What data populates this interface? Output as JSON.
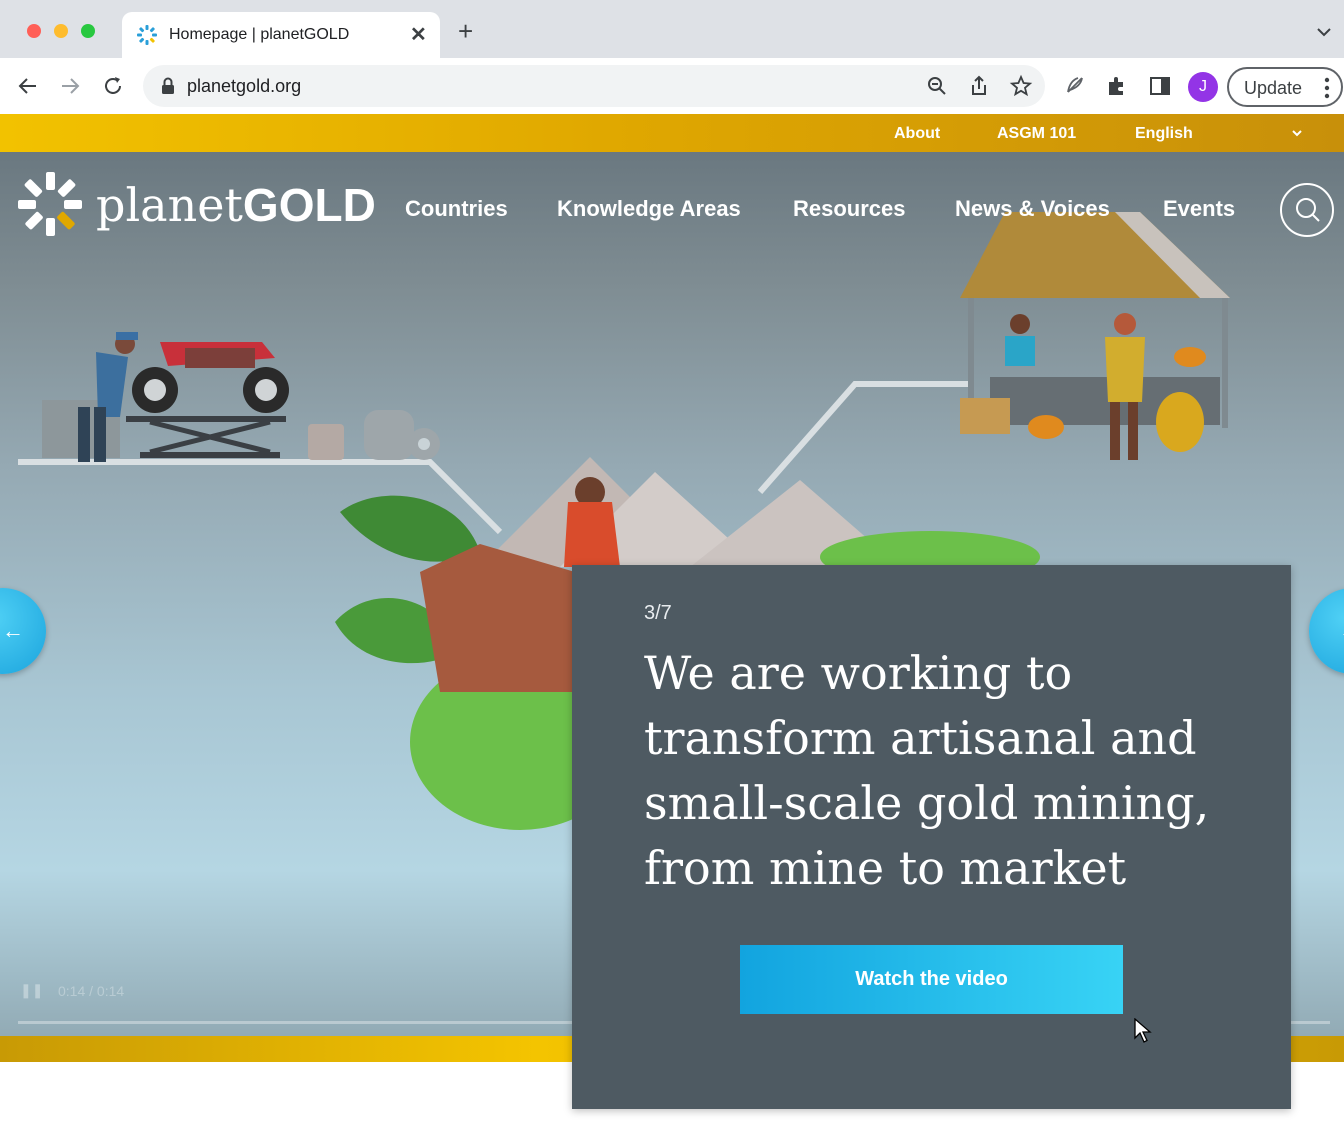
{
  "browser": {
    "tab_title": "Homepage | planetGOLD",
    "url": "planetgold.org",
    "avatar_initial": "J",
    "update_label": "Update"
  },
  "util_nav": {
    "about": "About",
    "asgm": "ASGM 101",
    "language": "English"
  },
  "logo": {
    "planet": "planet",
    "gold": "GOLD"
  },
  "main_nav": [
    "Countries",
    "Knowledge Areas",
    "Resources",
    "News & Voices",
    "Events"
  ],
  "hero": {
    "slide_counter": "3/7",
    "headline": "We are working to transform artisanal and small-scale gold mining, from mine to market",
    "cta_label": "Watch the video",
    "player_time": "0:14 / 0:14"
  },
  "colors": {
    "gold_accent": "#f2c200",
    "card_bg": "#4e5a62",
    "cta_start": "#12a4df",
    "cta_end": "#38d3f5",
    "arrow_blue": "#1ba4dd"
  }
}
